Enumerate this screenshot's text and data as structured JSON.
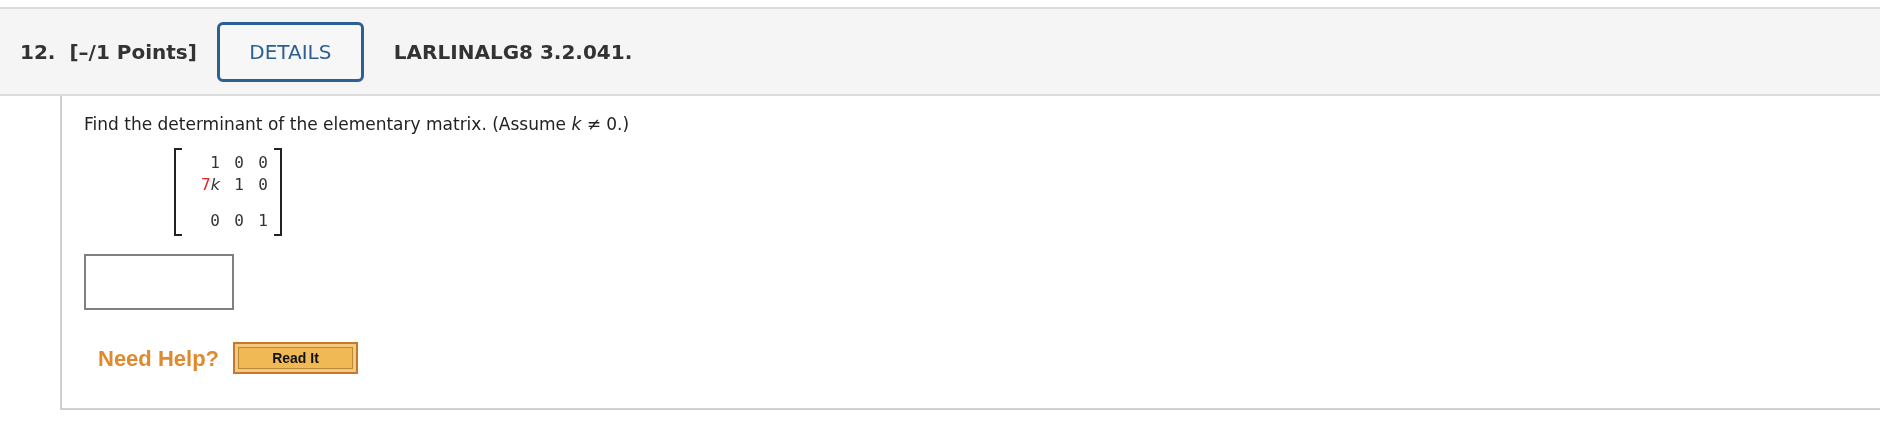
{
  "header": {
    "number": "12.",
    "points": "[–/1 Points]",
    "details_button": "DETAILS",
    "problem_id": "LARLINALG8 3.2.041."
  },
  "question": {
    "text": "Find the determinant of the elementary matrix. (Assume *k* ≠ 0.)",
    "matrix": [
      [
        {
          "text": "1"
        },
        {
          "text": "0"
        },
        {
          "text": "0"
        }
      ],
      [
        {
          "text": "7",
          "variable": "k",
          "color": "#e8251f"
        },
        {
          "text": "1"
        },
        {
          "text": "0"
        }
      ],
      [
        {
          "text": "0"
        },
        {
          "text": "0"
        },
        {
          "text": "1"
        }
      ]
    ]
  },
  "help": {
    "label": "Need Help?",
    "buttons": [
      "Read It"
    ]
  }
}
